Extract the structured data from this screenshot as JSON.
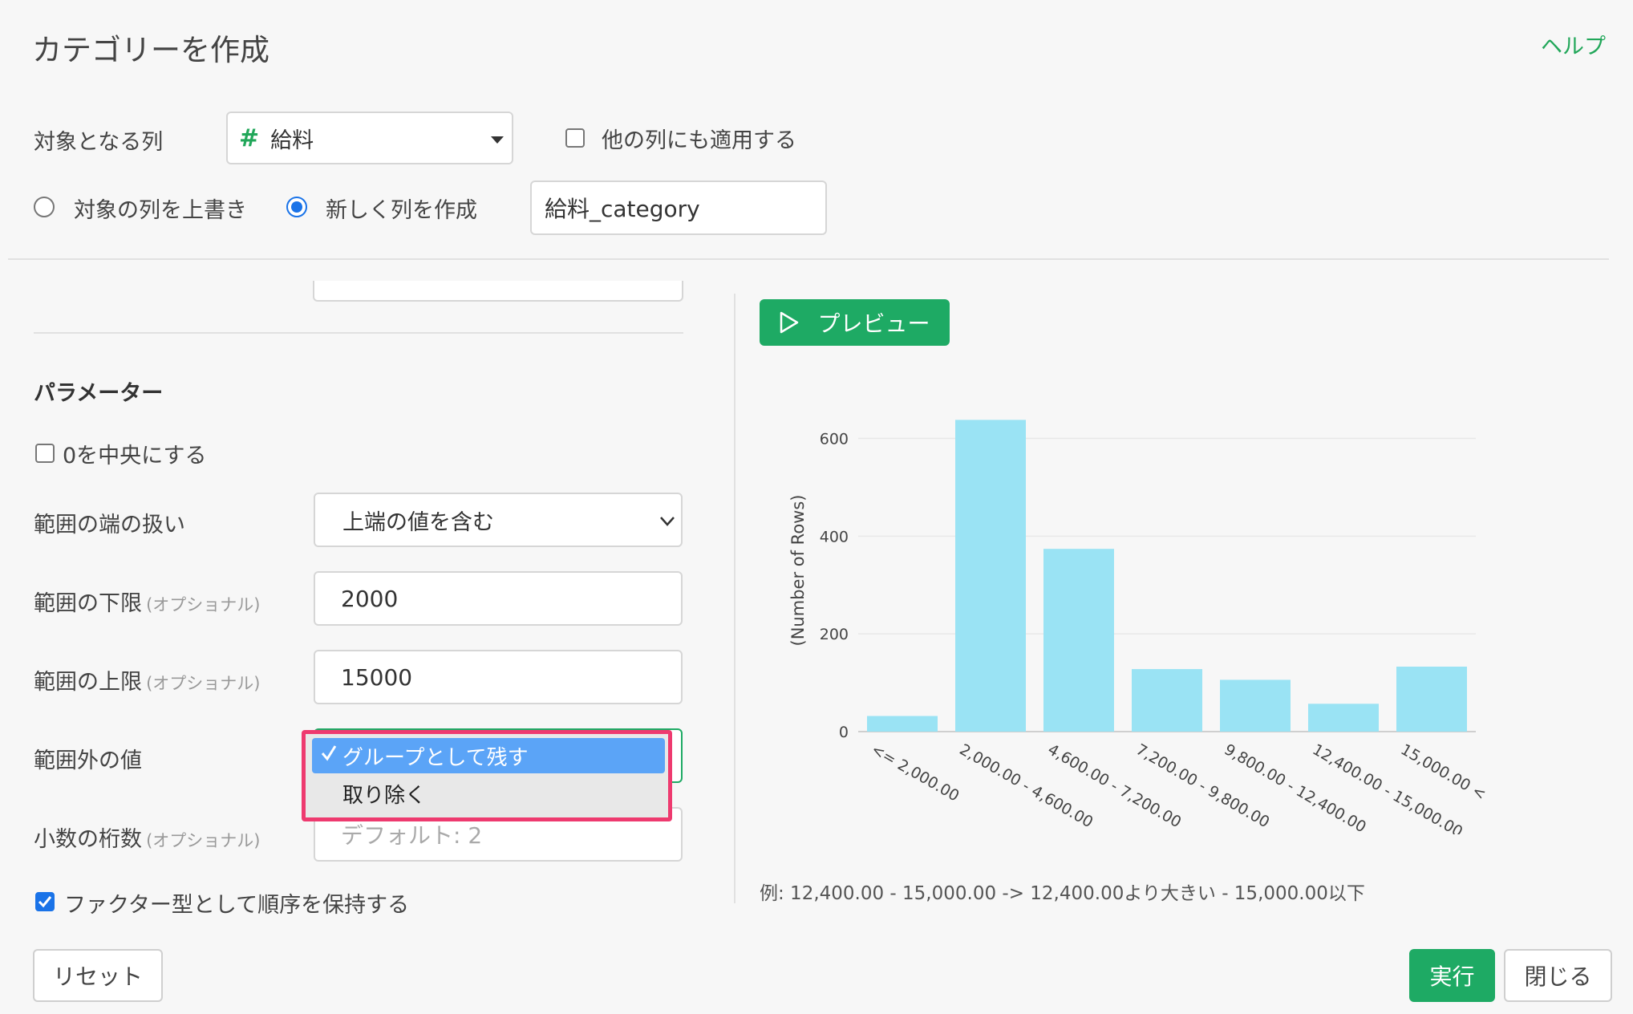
{
  "dialog": {
    "title": "カテゴリーを作成",
    "help_label": "ヘルプ"
  },
  "target": {
    "label": "対象となる列",
    "column_icon": "#",
    "column_value": "給料",
    "apply_others_label": "他の列にも適用する",
    "apply_others_checked": false
  },
  "output": {
    "overwrite_label": "対象の列を上書き",
    "new_column_label": "新しく列を作成",
    "selected": "new",
    "new_column_name": "給料_category"
  },
  "params": {
    "heading": "パラメーター",
    "center_zero_label": "0を中央にする",
    "center_zero_checked": false,
    "edge_label": "範囲の端の扱い",
    "edge_value": "上端の値を含む",
    "lower_label": "範囲の下限",
    "lower_optional": "(オプショナル)",
    "lower_value": "2000",
    "upper_label": "範囲の上限",
    "upper_optional": "(オプショナル)",
    "upper_value": "15000",
    "outside_label": "範囲外の値",
    "outside_options": [
      "グループとして残す",
      "取り除く"
    ],
    "outside_selected": "グループとして残す",
    "decimals_label": "小数の桁数",
    "decimals_optional": "(オプショナル)",
    "decimals_placeholder": "デフォルト: 2",
    "factor_label": "ファクター型として順序を保持する",
    "factor_checked": true
  },
  "preview": {
    "button_label": "プレビュー",
    "example_text": "例: 12,400.00 - 15,000.00 -> 12,400.00より大きい - 15,000.00以下"
  },
  "footer": {
    "reset_label": "リセット",
    "run_label": "実行",
    "close_label": "閉じる"
  },
  "colors": {
    "accent_green": "#1eaa64",
    "bar": "#9ae3f4",
    "highlight": "#ee3a6f",
    "selection_blue": "#5ba4f7"
  },
  "chart_data": {
    "type": "bar",
    "categories": [
      "<= 2,000.00",
      "2,000.00 - 4,600.00",
      "4,600.00 - 7,200.00",
      "7,200.00 - 9,800.00",
      "9,800.00 - 12,400.00",
      "12,400.00 - 15,000.00",
      "15,000.00 <"
    ],
    "values": [
      32,
      638,
      374,
      128,
      106,
      57,
      133
    ],
    "title": "",
    "xlabel": "",
    "ylabel": "(Number of Rows)",
    "ylim": [
      0,
      660
    ],
    "yticks": [
      0,
      200,
      400,
      600
    ],
    "grid": true
  }
}
